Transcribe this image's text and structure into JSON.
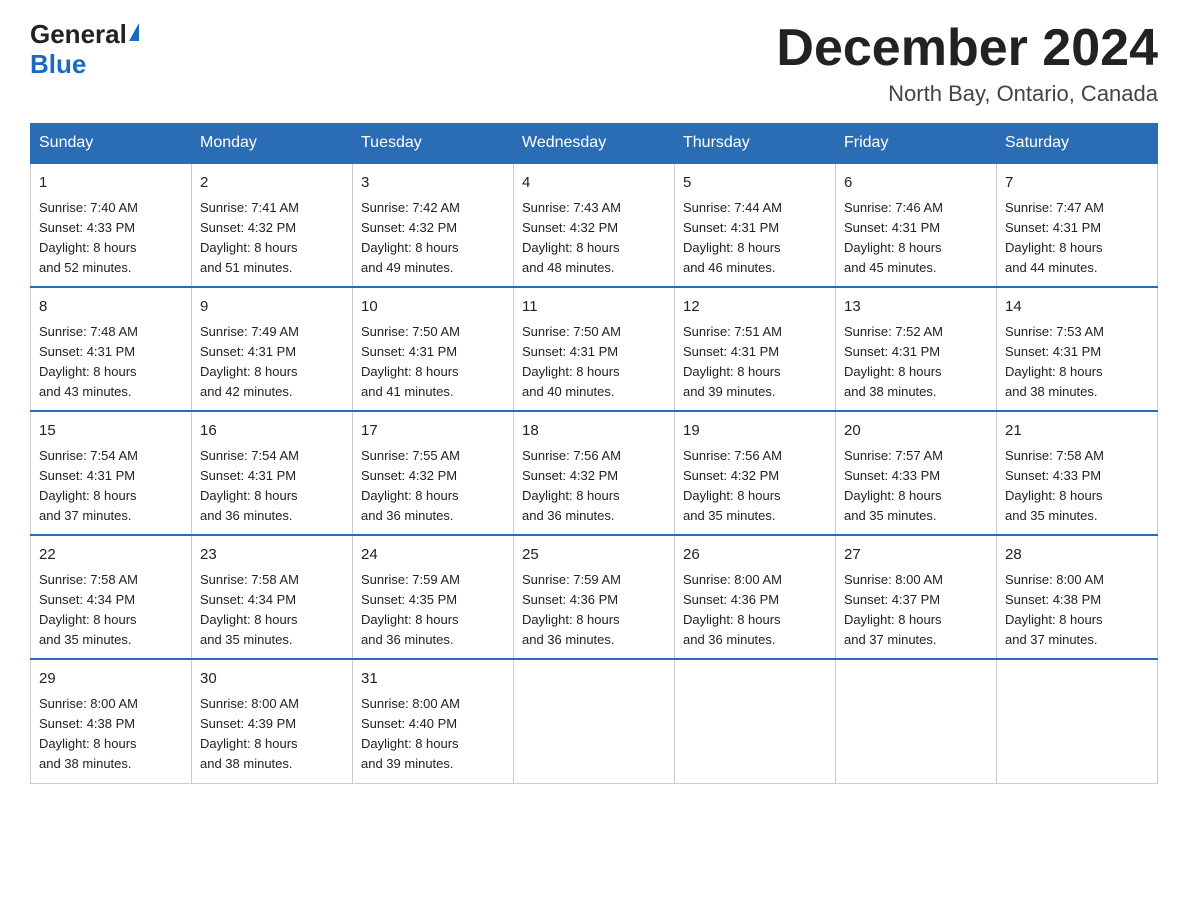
{
  "logo": {
    "general": "General",
    "blue": "Blue"
  },
  "header": {
    "month": "December 2024",
    "location": "North Bay, Ontario, Canada"
  },
  "weekdays": [
    "Sunday",
    "Monday",
    "Tuesday",
    "Wednesday",
    "Thursday",
    "Friday",
    "Saturday"
  ],
  "weeks": [
    [
      {
        "day": "1",
        "sunrise": "7:40 AM",
        "sunset": "4:33 PM",
        "daylight": "8 hours and 52 minutes."
      },
      {
        "day": "2",
        "sunrise": "7:41 AM",
        "sunset": "4:32 PM",
        "daylight": "8 hours and 51 minutes."
      },
      {
        "day": "3",
        "sunrise": "7:42 AM",
        "sunset": "4:32 PM",
        "daylight": "8 hours and 49 minutes."
      },
      {
        "day": "4",
        "sunrise": "7:43 AM",
        "sunset": "4:32 PM",
        "daylight": "8 hours and 48 minutes."
      },
      {
        "day": "5",
        "sunrise": "7:44 AM",
        "sunset": "4:31 PM",
        "daylight": "8 hours and 46 minutes."
      },
      {
        "day": "6",
        "sunrise": "7:46 AM",
        "sunset": "4:31 PM",
        "daylight": "8 hours and 45 minutes."
      },
      {
        "day": "7",
        "sunrise": "7:47 AM",
        "sunset": "4:31 PM",
        "daylight": "8 hours and 44 minutes."
      }
    ],
    [
      {
        "day": "8",
        "sunrise": "7:48 AM",
        "sunset": "4:31 PM",
        "daylight": "8 hours and 43 minutes."
      },
      {
        "day": "9",
        "sunrise": "7:49 AM",
        "sunset": "4:31 PM",
        "daylight": "8 hours and 42 minutes."
      },
      {
        "day": "10",
        "sunrise": "7:50 AM",
        "sunset": "4:31 PM",
        "daylight": "8 hours and 41 minutes."
      },
      {
        "day": "11",
        "sunrise": "7:50 AM",
        "sunset": "4:31 PM",
        "daylight": "8 hours and 40 minutes."
      },
      {
        "day": "12",
        "sunrise": "7:51 AM",
        "sunset": "4:31 PM",
        "daylight": "8 hours and 39 minutes."
      },
      {
        "day": "13",
        "sunrise": "7:52 AM",
        "sunset": "4:31 PM",
        "daylight": "8 hours and 38 minutes."
      },
      {
        "day": "14",
        "sunrise": "7:53 AM",
        "sunset": "4:31 PM",
        "daylight": "8 hours and 38 minutes."
      }
    ],
    [
      {
        "day": "15",
        "sunrise": "7:54 AM",
        "sunset": "4:31 PM",
        "daylight": "8 hours and 37 minutes."
      },
      {
        "day": "16",
        "sunrise": "7:54 AM",
        "sunset": "4:31 PM",
        "daylight": "8 hours and 36 minutes."
      },
      {
        "day": "17",
        "sunrise": "7:55 AM",
        "sunset": "4:32 PM",
        "daylight": "8 hours and 36 minutes."
      },
      {
        "day": "18",
        "sunrise": "7:56 AM",
        "sunset": "4:32 PM",
        "daylight": "8 hours and 36 minutes."
      },
      {
        "day": "19",
        "sunrise": "7:56 AM",
        "sunset": "4:32 PM",
        "daylight": "8 hours and 35 minutes."
      },
      {
        "day": "20",
        "sunrise": "7:57 AM",
        "sunset": "4:33 PM",
        "daylight": "8 hours and 35 minutes."
      },
      {
        "day": "21",
        "sunrise": "7:58 AM",
        "sunset": "4:33 PM",
        "daylight": "8 hours and 35 minutes."
      }
    ],
    [
      {
        "day": "22",
        "sunrise": "7:58 AM",
        "sunset": "4:34 PM",
        "daylight": "8 hours and 35 minutes."
      },
      {
        "day": "23",
        "sunrise": "7:58 AM",
        "sunset": "4:34 PM",
        "daylight": "8 hours and 35 minutes."
      },
      {
        "day": "24",
        "sunrise": "7:59 AM",
        "sunset": "4:35 PM",
        "daylight": "8 hours and 36 minutes."
      },
      {
        "day": "25",
        "sunrise": "7:59 AM",
        "sunset": "4:36 PM",
        "daylight": "8 hours and 36 minutes."
      },
      {
        "day": "26",
        "sunrise": "8:00 AM",
        "sunset": "4:36 PM",
        "daylight": "8 hours and 36 minutes."
      },
      {
        "day": "27",
        "sunrise": "8:00 AM",
        "sunset": "4:37 PM",
        "daylight": "8 hours and 37 minutes."
      },
      {
        "day": "28",
        "sunrise": "8:00 AM",
        "sunset": "4:38 PM",
        "daylight": "8 hours and 37 minutes."
      }
    ],
    [
      {
        "day": "29",
        "sunrise": "8:00 AM",
        "sunset": "4:38 PM",
        "daylight": "8 hours and 38 minutes."
      },
      {
        "day": "30",
        "sunrise": "8:00 AM",
        "sunset": "4:39 PM",
        "daylight": "8 hours and 38 minutes."
      },
      {
        "day": "31",
        "sunrise": "8:00 AM",
        "sunset": "4:40 PM",
        "daylight": "8 hours and 39 minutes."
      },
      null,
      null,
      null,
      null
    ]
  ],
  "labels": {
    "sunrise": "Sunrise:",
    "sunset": "Sunset:",
    "daylight": "Daylight:"
  }
}
